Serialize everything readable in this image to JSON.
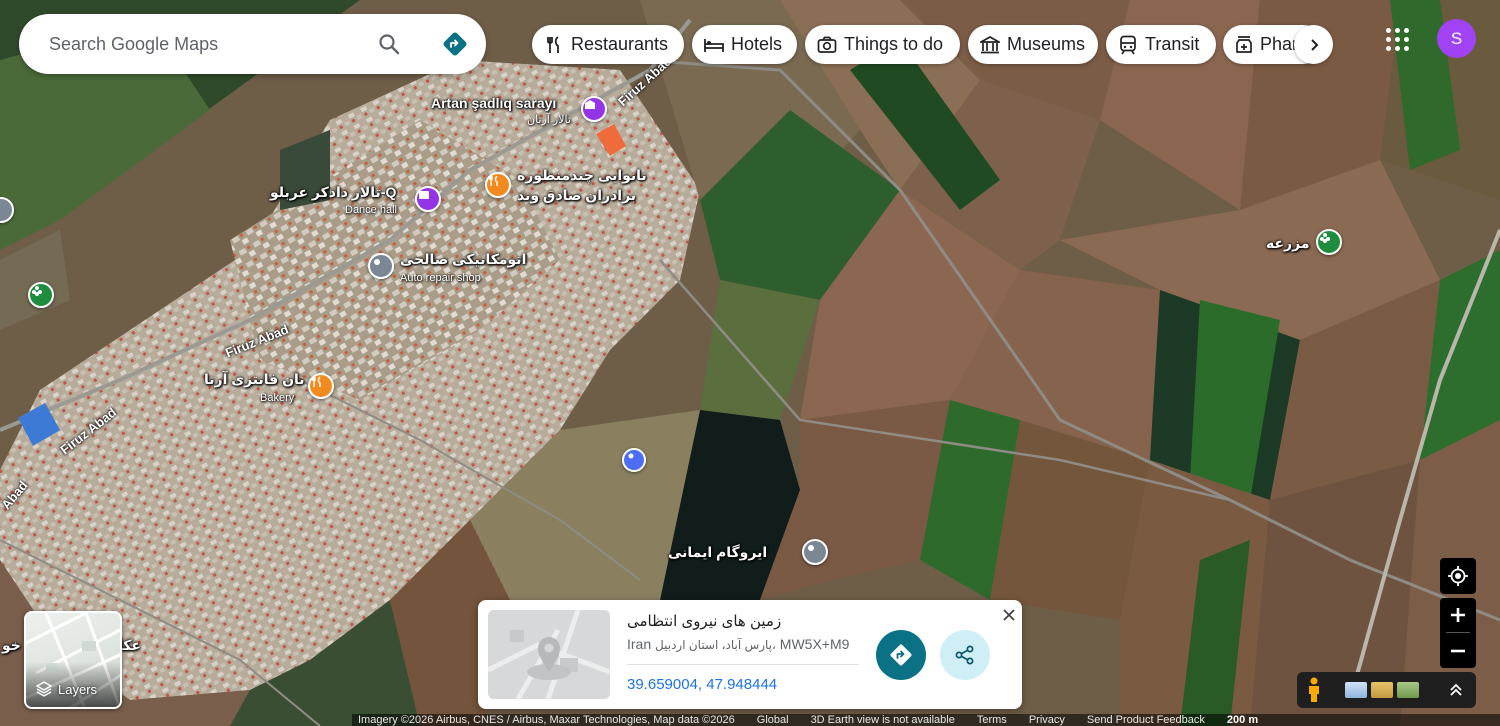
{
  "search": {
    "placeholder": "Search Google Maps"
  },
  "chips": [
    {
      "label": "Restaurants",
      "icon": "fork-knife-icon"
    },
    {
      "label": "Hotels",
      "icon": "bed-icon"
    },
    {
      "label": "Things to do",
      "icon": "camera-icon"
    },
    {
      "label": "Museums",
      "icon": "museum-icon"
    },
    {
      "label": "Transit",
      "icon": "train-icon"
    },
    {
      "label": "Pharmacies",
      "icon": "pharmacy-icon"
    }
  ],
  "account": {
    "initial": "S",
    "color": "#a142f4"
  },
  "map_labels": {
    "artan": "Artan şadlıq sarayı",
    "artan_fa": "تالار آرتان",
    "dance_fa": "تالار دادکر عربلو-Q",
    "dance_en": "Dance hall",
    "bakery1_fa_1": "نانوایی چندمنظوره",
    "bakery1_fa_2": "برادران صادق وند",
    "auto_fa": "اتومکانیکی صالحی",
    "auto_en": "Auto repair shop",
    "bakery2_fa": "نان فانتزی آرنا",
    "bakery2_en": "Bakery",
    "farm_fa": "مزرعه",
    "agro_fa": "ایروگام ایمانی",
    "left_edge": "عکا",
    "left_edge2": "خو"
  },
  "roads": {
    "firuz1": "Firuz Abad",
    "firuz2": "Firuz Abad",
    "firuz3": "Firuz Abad",
    "firuz4": "Firuz Abad",
    "abad": "Abad"
  },
  "layers": {
    "label": "Layers"
  },
  "place": {
    "title": "زمین های نیروی انتظامی",
    "address_code": "MW5X+M9",
    "address_local": "پارس آباد، استان اردبیل،",
    "address_country": "Iran",
    "coords": "39.659004, 47.948444"
  },
  "footer": {
    "imagery": "Imagery ©2026 Airbus, CNES / Airbus, Maxar Technologies, Map data ©2026",
    "global": "Global",
    "earth": "3D Earth view is not available",
    "terms": "Terms",
    "privacy": "Privacy",
    "feedback": "Send Product Feedback",
    "scale": "200 m"
  },
  "colors": {
    "restaurant_pin": "#f28b1f",
    "venue_pin": "#9334e6",
    "service_pin": "#7b8794",
    "farm_pin": "#1e8e3e",
    "primary_action": "#0b7285"
  }
}
